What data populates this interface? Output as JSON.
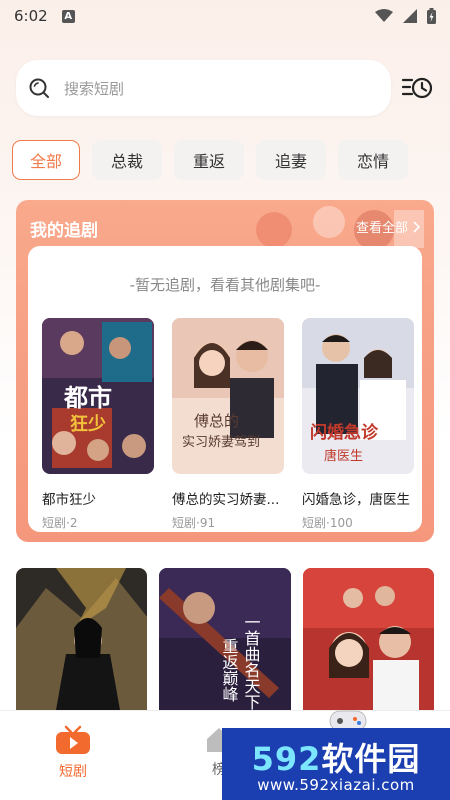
{
  "status_bar": {
    "time": "6:02",
    "notif_letter": "A"
  },
  "search": {
    "placeholder": "搜索短剧"
  },
  "tabs": [
    {
      "label": "全部",
      "active": true
    },
    {
      "label": "总裁"
    },
    {
      "label": "重返"
    },
    {
      "label": "追妻"
    },
    {
      "label": "恋情"
    }
  ],
  "follow": {
    "title": "我的追剧",
    "view_all": "查看全部",
    "empty_text": "-暂无追剧，看看其他剧集吧-",
    "dramas": [
      {
        "name": "都市狂少",
        "count": "短剧·2",
        "poster_text": "都市狂少"
      },
      {
        "name": "傅总的实习娇妻...",
        "count": "短剧·91",
        "poster_text": "傅总的实习娇妻驾到"
      },
      {
        "name": "闪婚急诊，唐医生",
        "count": "短剧·100",
        "poster_text": "闪婚急诊唐医生"
      }
    ]
  },
  "grid_posters": [
    {
      "poster_text": ""
    },
    {
      "poster_text": "一首曲名天下 重返巅峰"
    },
    {
      "poster_text": ""
    }
  ],
  "bottom_nav": [
    {
      "label": "短剧",
      "active": true
    },
    {
      "label": "榜"
    }
  ],
  "watermark": {
    "logo_num": "592",
    "logo_text": "软件园",
    "url": "www.592xiazai.com"
  },
  "colors": {
    "accent": "#f07a4a",
    "card": "#f7a085"
  }
}
